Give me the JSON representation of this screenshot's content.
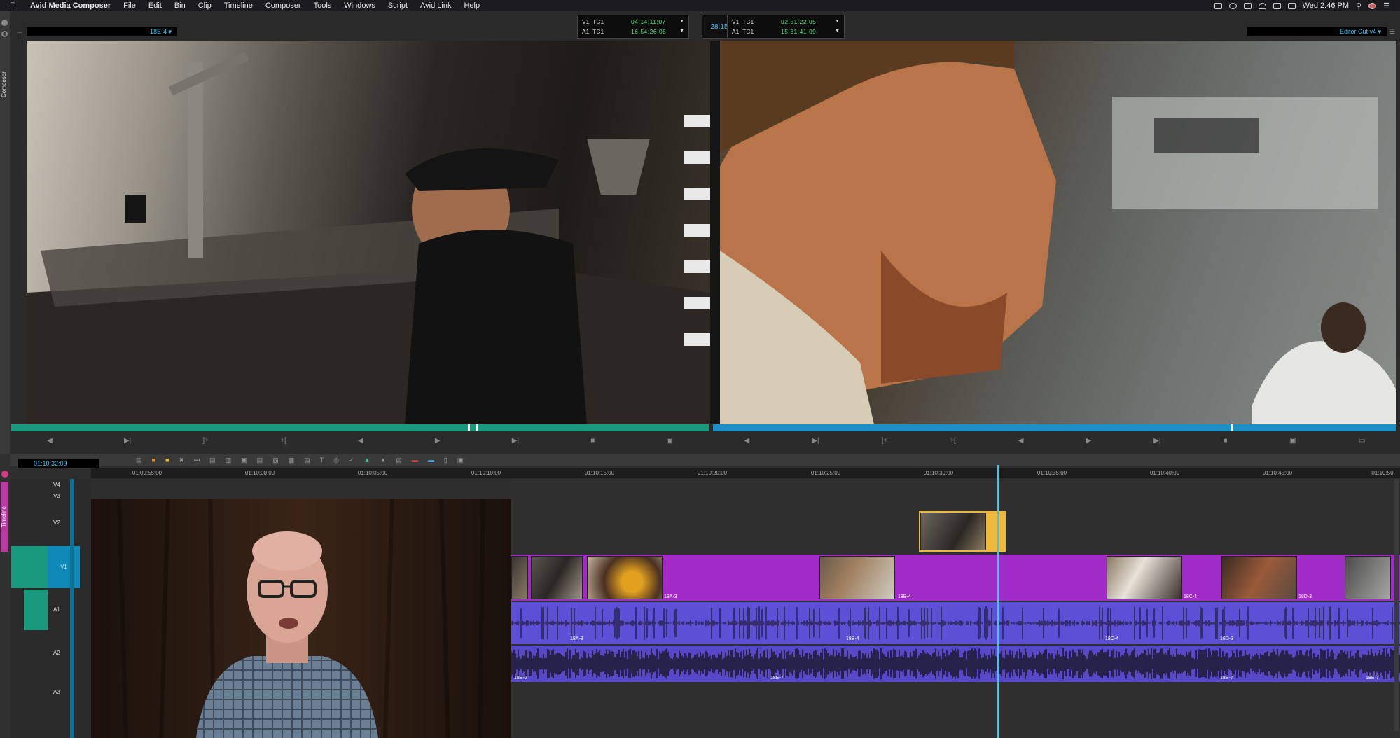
{
  "menubar": {
    "items": [
      "Avid Media Composer",
      "File",
      "Edit",
      "Bin",
      "Clip",
      "Timeline",
      "Composer",
      "Tools",
      "Windows",
      "Script",
      "Avid Link",
      "Help"
    ],
    "clock": "Wed 2:46 PM"
  },
  "composer": {
    "tab_label": "Composer",
    "source_clip": "18E-4",
    "record_sequence": "Editor Cut v4",
    "source_tc": [
      {
        "track": "V1",
        "type": "TC1",
        "value": "04:14:11:07"
      },
      {
        "track": "A1",
        "type": "TC1",
        "value": "16:54:26:05"
      }
    ],
    "center_duration": "28:15",
    "record_tc": [
      {
        "track": "V1",
        "type": "TC1",
        "value": "02:51:22:05"
      },
      {
        "track": "A1",
        "type": "TC1",
        "value": "15:31:41:09"
      }
    ]
  },
  "timeline": {
    "tab_label": "Timeline",
    "current_tc": "01:10:32:09",
    "ruler": [
      "01:09:55:00",
      "01:10:00:00",
      "01:10:05:00",
      "01:10:10:00",
      "01:10:15:00",
      "01:10:20:00",
      "01:10:25:00",
      "01:10:30:00",
      "01:10:35:00",
      "01:10:40:00",
      "01:10:45:00",
      "01:10:50"
    ],
    "tracks": [
      "V4",
      "V3",
      "V2",
      "V1",
      "A1",
      "A2",
      "A3"
    ],
    "v1_clips": [
      "18A-3",
      "18B-4",
      "18C-4",
      "18D-3"
    ],
    "a1_clips": [
      "18A-3",
      "18B-4",
      "18C-4",
      "18D-3"
    ],
    "a2_clips": [
      "18E-2",
      "18E-7",
      "18E-7",
      "18E-7"
    ]
  },
  "colors": {
    "source_bar": "#1a9a7c",
    "record_bar": "#1c8fc4",
    "video_clip": "#a22cc8",
    "audio_clip": "#5d4fd6",
    "v2_clip": "#f0b73a",
    "playhead": "#3cc6e8"
  }
}
